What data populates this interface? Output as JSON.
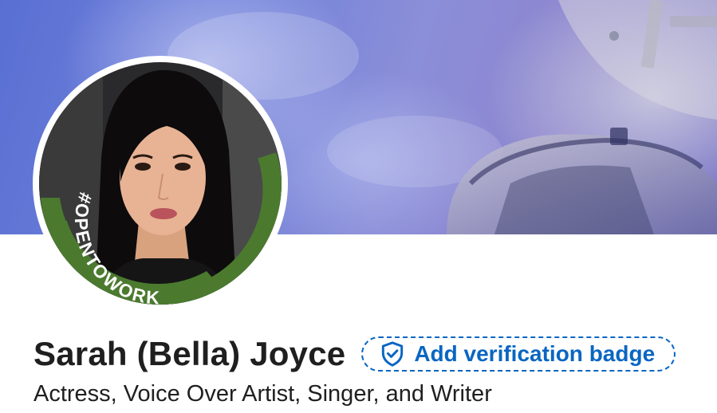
{
  "profile": {
    "name": "Sarah (Bella) Joyce",
    "headline": "Actress, Voice Over Artist, Singer, and Writer",
    "open_to_work_frame": "#OPENTOWORK"
  },
  "verification": {
    "label": "Add verification badge",
    "icon": "shield-check-icon"
  },
  "colors": {
    "accent": "#0a66c2",
    "open_to_work_green": "#4b7a2f",
    "text": "#1f1f1f"
  }
}
